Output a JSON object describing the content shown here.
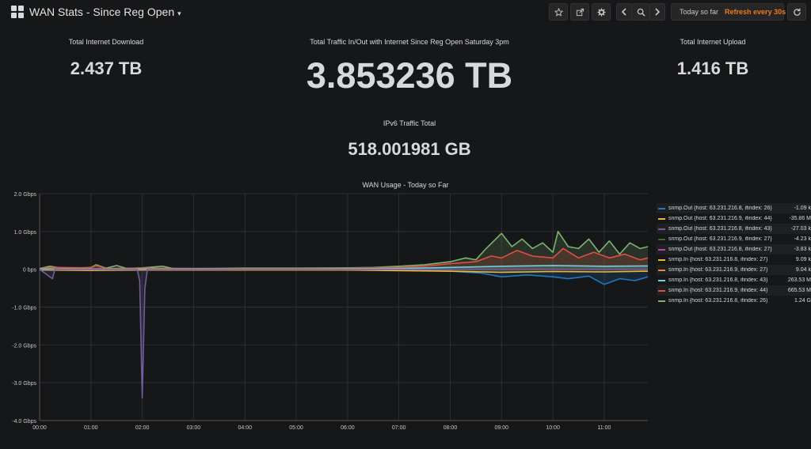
{
  "header": {
    "title": "WAN Stats - Since Reg Open",
    "time_range": "Today so far",
    "refresh": "Refresh every 30s"
  },
  "stats": {
    "download": {
      "title": "Total Internet Download",
      "value": "2.437 TB"
    },
    "total": {
      "title": "Total Traffic In/Out with Internet Since Reg Open Saturday 3pm",
      "value": "3.853236 TB"
    },
    "upload": {
      "title": "Total Internet Upload",
      "value": "1.416 TB"
    },
    "ipv6": {
      "title": "IPv6 Traffic Total",
      "value": "518.001981 GB"
    }
  },
  "graph": {
    "title": "WAN Usage - Today so Far",
    "legend": [
      {
        "name": "snmp.Out {host: 63.231.216.8, ifindex: 26}",
        "value": "-1.09 k",
        "color": "#1f78c1"
      },
      {
        "name": "snmp.Out {host: 63.231.216.9, ifindex: 44}",
        "value": "-35.86 M",
        "color": "#eab839"
      },
      {
        "name": "snmp.Out {host: 63.231.216.8, ifindex: 43}",
        "value": "-27.03 k",
        "color": "#705da0"
      },
      {
        "name": "snmp.Out {host: 63.231.216.9, ifindex: 27}",
        "value": "-4.23 k",
        "color": "#3f6833"
      },
      {
        "name": "snmp.Out {host: 63.231.216.8, ifindex: 27}",
        "value": "-3.83 k",
        "color": "#ba43a9"
      },
      {
        "name": "snmp.In {host: 63.231.216.8, ifindex: 27}",
        "value": "9.09 k",
        "color": "#eab839"
      },
      {
        "name": "snmp.In {host: 63.231.216.9, ifindex: 27}",
        "value": "9.04 k",
        "color": "#ef843c"
      },
      {
        "name": "snmp.In {host: 63.231.216.8, ifindex: 43}",
        "value": "263.53 M",
        "color": "#6ed0e0"
      },
      {
        "name": "snmp.In {host: 63.231.216.9, ifindex: 44}",
        "value": "665.53 M",
        "color": "#e24d42"
      },
      {
        "name": "snmp.In {host: 63.231.216.8, ifindex: 26}",
        "value": "1.24 G",
        "color": "#7eb26d"
      }
    ]
  },
  "chart_data": {
    "type": "line",
    "title": "WAN Usage - Today so Far",
    "y_ticks": [
      "2.0 Gbps",
      "1.0 Gbps",
      "0 bps",
      "-1.0 Gbps",
      "-2.0 Gbps",
      "-3.0 Gbps",
      "-4.0 Gbps"
    ],
    "x_ticks": [
      "00:00",
      "01:00",
      "02:00",
      "03:00",
      "04:00",
      "05:00",
      "06:00",
      "07:00",
      "08:00",
      "09:00",
      "10:00",
      "11:00"
    ],
    "ylim_gbps": [
      -4.0,
      2.0
    ],
    "x_range_hours": [
      0,
      11.85
    ],
    "grid": true,
    "legend_position": "right",
    "series": [
      {
        "name": "snmp.In {host: 63.231.216.8, ifindex: 26}",
        "color": "#7eb26d",
        "points_hours_gbps": [
          [
            0,
            0.02
          ],
          [
            0.2,
            0.08
          ],
          [
            0.5,
            0.02
          ],
          [
            1,
            0.05
          ],
          [
            1.1,
            0.12
          ],
          [
            1.3,
            0.03
          ],
          [
            1.5,
            0.1
          ],
          [
            1.7,
            0.02
          ],
          [
            2,
            0.04
          ],
          [
            2.4,
            0.08
          ],
          [
            2.6,
            0.02
          ],
          [
            3,
            0.02
          ],
          [
            4,
            0.03
          ],
          [
            5,
            0.03
          ],
          [
            6,
            0.04
          ],
          [
            6.5,
            0.05
          ],
          [
            7,
            0.08
          ],
          [
            7.5,
            0.12
          ],
          [
            8,
            0.2
          ],
          [
            8.3,
            0.3
          ],
          [
            8.5,
            0.25
          ],
          [
            8.7,
            0.55
          ],
          [
            9,
            0.95
          ],
          [
            9.2,
            0.6
          ],
          [
            9.4,
            0.8
          ],
          [
            9.6,
            0.55
          ],
          [
            9.8,
            0.7
          ],
          [
            10,
            0.45
          ],
          [
            10.1,
            1.0
          ],
          [
            10.3,
            0.6
          ],
          [
            10.5,
            0.55
          ],
          [
            10.7,
            0.8
          ],
          [
            10.9,
            0.45
          ],
          [
            11.1,
            0.75
          ],
          [
            11.3,
            0.4
          ],
          [
            11.5,
            0.7
          ],
          [
            11.7,
            0.55
          ],
          [
            11.85,
            0.6
          ]
        ]
      },
      {
        "name": "snmp.In {host: 63.231.216.9, ifindex: 44}",
        "color": "#e24d42",
        "points_hours_gbps": [
          [
            0,
            0.02
          ],
          [
            0.3,
            0.05
          ],
          [
            1,
            0.04
          ],
          [
            1.1,
            0.1
          ],
          [
            1.3,
            0.02
          ],
          [
            2,
            0.03
          ],
          [
            3,
            0.02
          ],
          [
            4,
            0.02
          ],
          [
            5,
            0.02
          ],
          [
            6,
            0.03
          ],
          [
            7,
            0.05
          ],
          [
            7.5,
            0.08
          ],
          [
            8,
            0.15
          ],
          [
            8.5,
            0.2
          ],
          [
            8.8,
            0.35
          ],
          [
            9,
            0.3
          ],
          [
            9.3,
            0.5
          ],
          [
            9.6,
            0.35
          ],
          [
            10,
            0.3
          ],
          [
            10.2,
            0.55
          ],
          [
            10.5,
            0.3
          ],
          [
            10.8,
            0.45
          ],
          [
            11.1,
            0.3
          ],
          [
            11.4,
            0.4
          ],
          [
            11.7,
            0.25
          ],
          [
            11.85,
            0.3
          ]
        ]
      },
      {
        "name": "snmp.In {host: 63.231.216.8, ifindex: 43}",
        "color": "#6ed0e0",
        "points_hours_gbps": [
          [
            0,
            0.01
          ],
          [
            2,
            0.01
          ],
          [
            5,
            0.01
          ],
          [
            7,
            0.02
          ],
          [
            8,
            0.05
          ],
          [
            9,
            0.08
          ],
          [
            10,
            0.1
          ],
          [
            11,
            0.08
          ],
          [
            11.85,
            0.09
          ]
        ]
      },
      {
        "name": "snmp.Out {host: 63.231.216.8, ifindex: 26}",
        "color": "#1f78c1",
        "points_hours_gbps": [
          [
            0,
            -0.01
          ],
          [
            2,
            -0.01
          ],
          [
            5,
            -0.01
          ],
          [
            7,
            -0.02
          ],
          [
            8,
            -0.05
          ],
          [
            8.6,
            -0.1
          ],
          [
            9,
            -0.2
          ],
          [
            9.5,
            -0.15
          ],
          [
            10,
            -0.2
          ],
          [
            10.3,
            -0.25
          ],
          [
            10.7,
            -0.18
          ],
          [
            11,
            -0.4
          ],
          [
            11.3,
            -0.25
          ],
          [
            11.6,
            -0.3
          ],
          [
            11.85,
            -0.2
          ]
        ]
      },
      {
        "name": "snmp.Out {host: 63.231.216.9, ifindex: 44}",
        "color": "#eab839",
        "points_hours_gbps": [
          [
            0,
            -0.02
          ],
          [
            1,
            -0.03
          ],
          [
            2,
            -0.02
          ],
          [
            4,
            -0.02
          ],
          [
            6,
            -0.02
          ],
          [
            8,
            -0.05
          ],
          [
            9,
            -0.08
          ],
          [
            10,
            -0.06
          ],
          [
            11,
            -0.07
          ],
          [
            11.85,
            -0.05
          ]
        ]
      },
      {
        "name": "snmp.Out {host: 63.231.216.8, ifindex: 43}",
        "color": "#705da0",
        "points_hours_gbps": [
          [
            0,
            0
          ],
          [
            0.25,
            -0.25
          ],
          [
            0.3,
            0
          ],
          [
            1.9,
            0
          ],
          [
            1.95,
            -0.3
          ],
          [
            2.0,
            -3.4
          ],
          [
            2.05,
            -0.5
          ],
          [
            2.1,
            0
          ],
          [
            11.85,
            0
          ]
        ]
      }
    ]
  }
}
